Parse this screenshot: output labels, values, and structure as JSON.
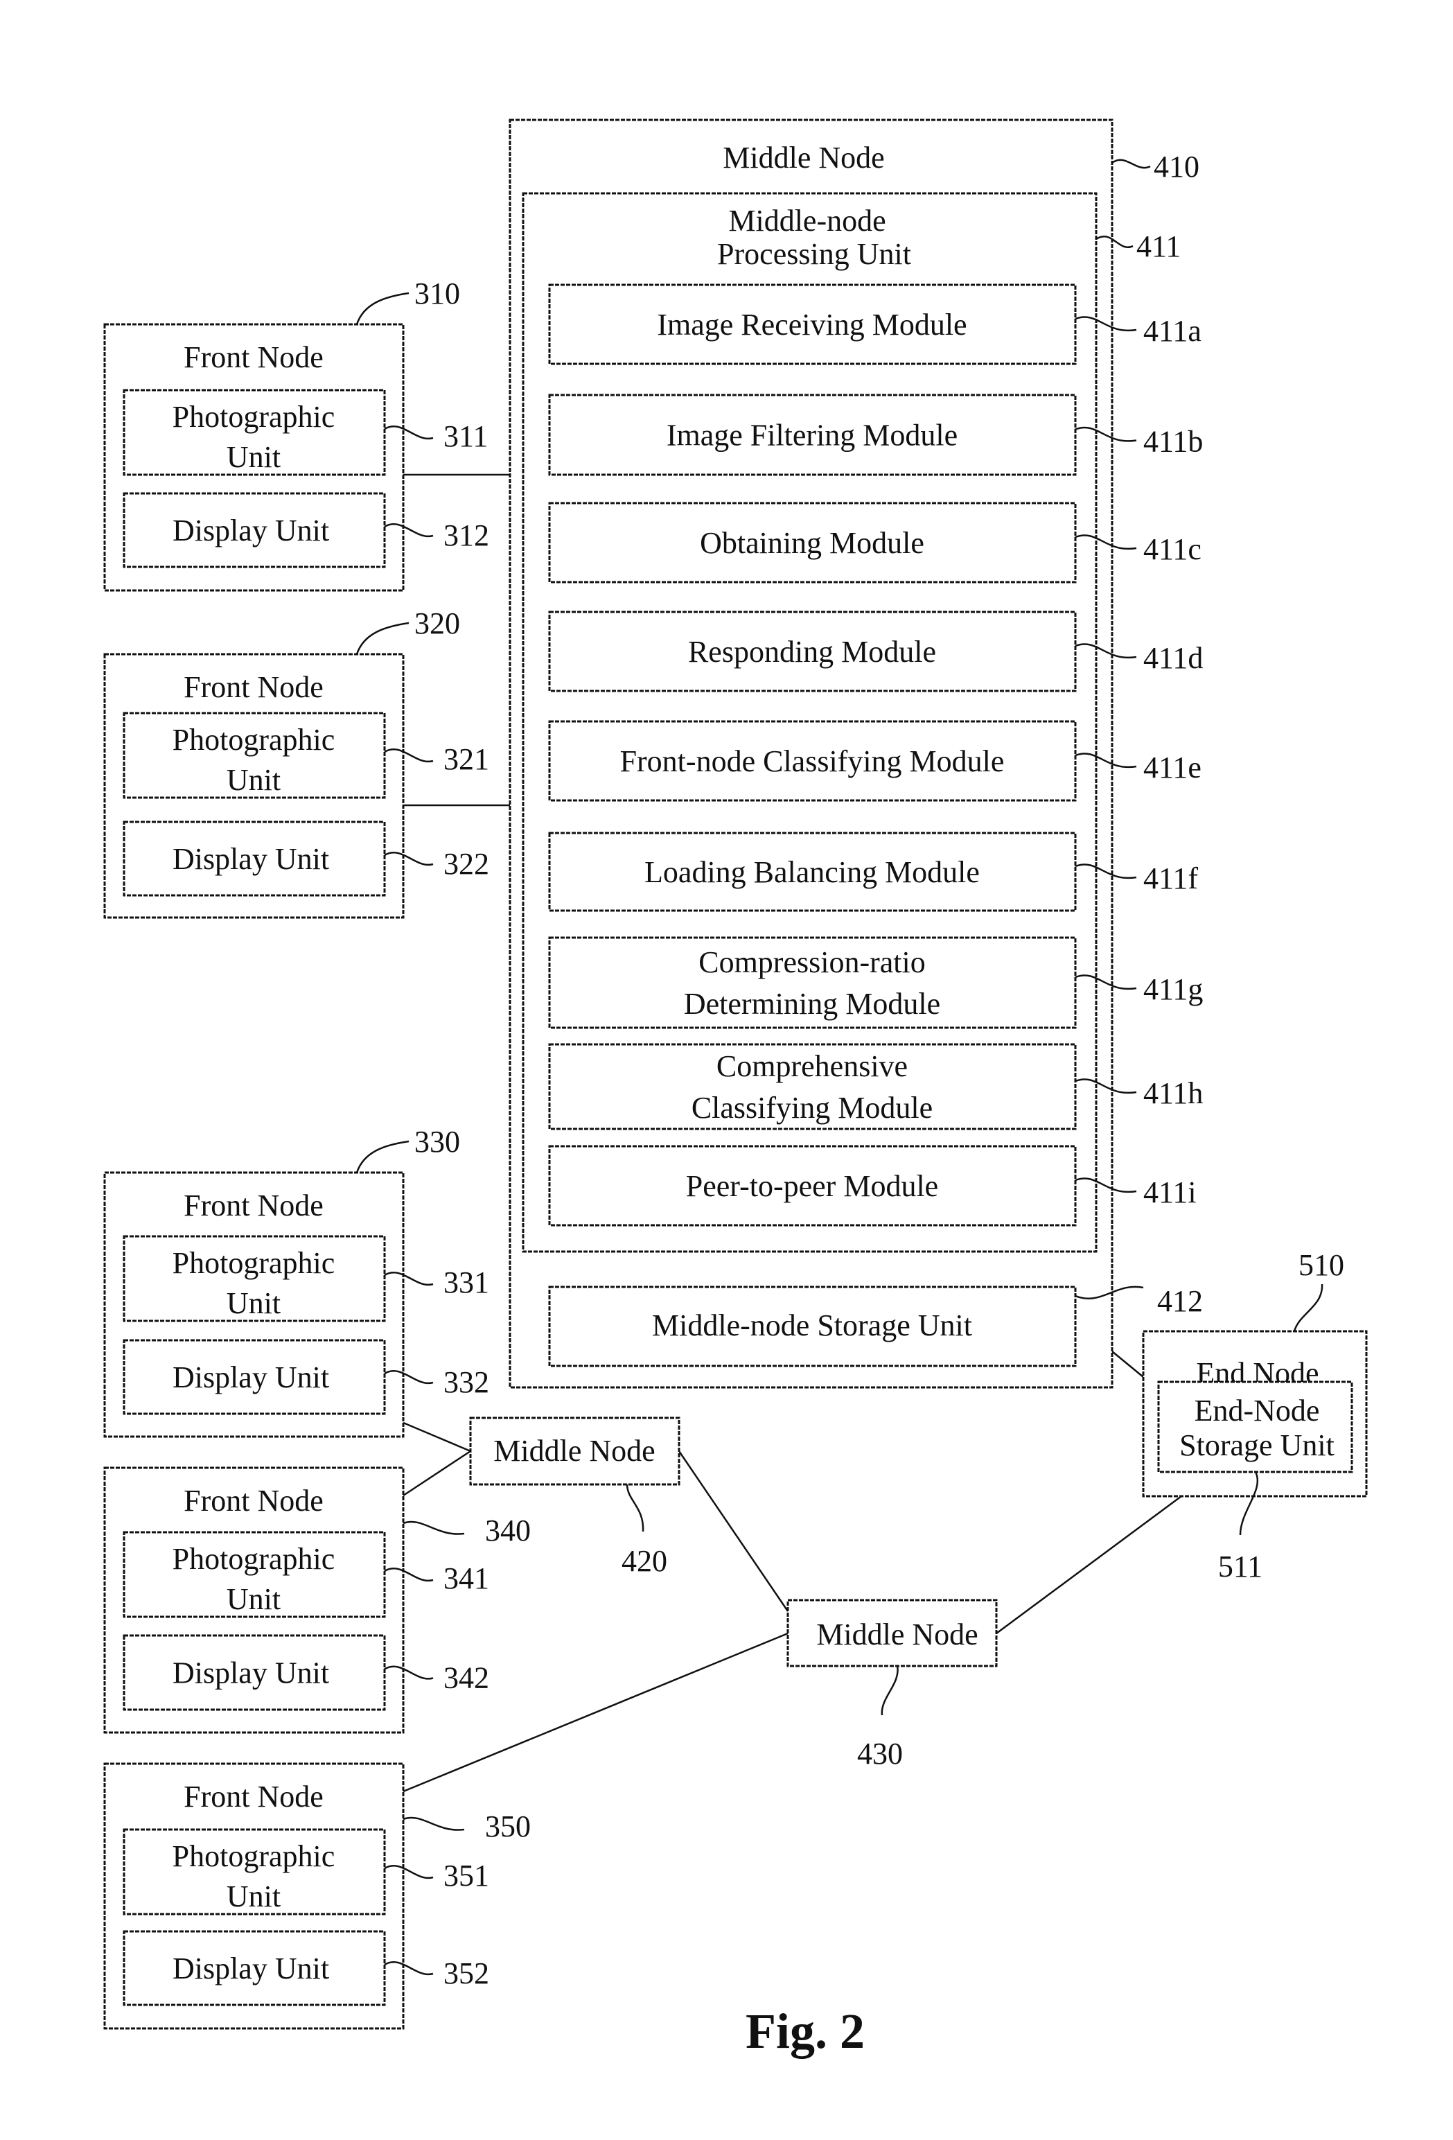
{
  "figure": {
    "caption": "Fig. 2"
  },
  "middle_node_main": {
    "title": "Middle Node",
    "ref": "410",
    "processing_unit": {
      "title_line1": "Middle-node",
      "title_line2": "Processing Unit",
      "ref": "411",
      "modules": [
        {
          "lines": [
            "Image Receiving Module"
          ],
          "ref": "411a"
        },
        {
          "lines": [
            "Image Filtering Module"
          ],
          "ref": "411b"
        },
        {
          "lines": [
            "Obtaining Module"
          ],
          "ref": "411c"
        },
        {
          "lines": [
            "Responding Module"
          ],
          "ref": "411d"
        },
        {
          "lines": [
            "Front-node Classifying Module"
          ],
          "ref": "411e"
        },
        {
          "lines": [
            "Loading Balancing Module"
          ],
          "ref": "411f"
        },
        {
          "lines": [
            "Compression-ratio",
            "Determining Module"
          ],
          "ref": "411g"
        },
        {
          "lines": [
            "Comprehensive",
            "Classifying Module"
          ],
          "ref": "411h"
        },
        {
          "lines": [
            "Peer-to-peer Module"
          ],
          "ref": "411i"
        }
      ]
    },
    "storage_unit": {
      "label": "Middle-node Storage Unit",
      "ref": "412"
    }
  },
  "front_nodes": [
    {
      "title": "Front Node",
      "ref": "310",
      "photo": {
        "line1": "Photographic",
        "line2": "Unit",
        "ref": "311"
      },
      "display": {
        "label": "Display Unit",
        "ref": "312"
      }
    },
    {
      "title": "Front Node",
      "ref": "320",
      "photo": {
        "line1": "Photographic",
        "line2": "Unit",
        "ref": "321"
      },
      "display": {
        "label": "Display Unit",
        "ref": "322"
      }
    },
    {
      "title": "Front Node",
      "ref": "330",
      "photo": {
        "line1": "Photographic",
        "line2": "Unit",
        "ref": "331"
      },
      "display": {
        "label": "Display Unit",
        "ref": "332"
      }
    },
    {
      "title": "Front Node",
      "ref": "340",
      "photo": {
        "line1": "Photographic",
        "line2": "Unit",
        "ref": "341"
      },
      "display": {
        "label": "Display Unit",
        "ref": "342"
      }
    },
    {
      "title": "Front Node",
      "ref": "350",
      "photo": {
        "line1": "Photographic",
        "line2": "Unit",
        "ref": "351"
      },
      "display": {
        "label": "Display Unit",
        "ref": "352"
      }
    }
  ],
  "middle_nodes_secondary": [
    {
      "title": "Middle Node",
      "ref": "420"
    },
    {
      "title": "Middle Node",
      "ref": "430"
    }
  ],
  "end_node": {
    "title": "End Node",
    "ref": "510",
    "storage": {
      "line1": "End-Node",
      "line2": "Storage Unit",
      "ref": "511"
    }
  }
}
